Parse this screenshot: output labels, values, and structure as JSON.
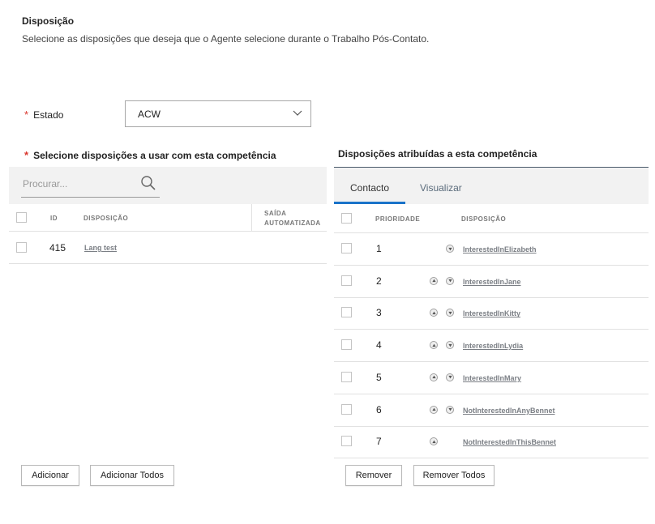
{
  "header": {
    "title": "Disposição",
    "description": "Selecione as disposições que deseja que o Agente selecione durante o Trabalho Pós-Contato."
  },
  "state": {
    "required_mark": "*",
    "label": "Estado",
    "value": "ACW"
  },
  "left": {
    "required_mark": "*",
    "title": "Selecione disposições a usar com esta competência",
    "search_placeholder": "Procurar...",
    "columns": {
      "id": "ID",
      "disposition": "DISPOSIÇÃO",
      "auto_exit_line1": "SAÍDA",
      "auto_exit_line2": "AUTOMATIZADA"
    },
    "rows": [
      {
        "id": "415",
        "disposition": "Lang test"
      }
    ],
    "add_button": "Adicionar",
    "add_all_button": "Adicionar Todos"
  },
  "right": {
    "title": "Disposições atribuídas a esta competência",
    "tabs": [
      {
        "label": "Contacto",
        "active": true
      },
      {
        "label": "Visualizar",
        "active": false
      }
    ],
    "columns": {
      "priority": "PRIORIDADE",
      "disposition": "DISPOSIÇÃO"
    },
    "rows": [
      {
        "priority": "1",
        "disposition": "InterestedInElizabeth",
        "up": false,
        "down": true
      },
      {
        "priority": "2",
        "disposition": "InterestedInJane",
        "up": true,
        "down": true
      },
      {
        "priority": "3",
        "disposition": "InterestedInKitty",
        "up": true,
        "down": true
      },
      {
        "priority": "4",
        "disposition": "InterestedInLydia",
        "up": true,
        "down": true
      },
      {
        "priority": "5",
        "disposition": "InterestedInMary",
        "up": true,
        "down": true
      },
      {
        "priority": "6",
        "disposition": "NotInterestedInAnyBennet",
        "up": true,
        "down": true
      },
      {
        "priority": "7",
        "disposition": "NotInterestedInThisBennet",
        "up": true,
        "down": false
      }
    ],
    "remove_button": "Remover",
    "remove_all_button": "Remover Todos"
  },
  "colors": {
    "accent_tab": "#1a73c9",
    "required": "#d9342b",
    "link": "#7b7f85",
    "panel_bg": "#f2f2f2"
  },
  "icons": {
    "search": "search-icon",
    "dropdown": "chevron-down-icon",
    "move_up": "arrow-up-icon",
    "move_down": "arrow-down-icon"
  }
}
